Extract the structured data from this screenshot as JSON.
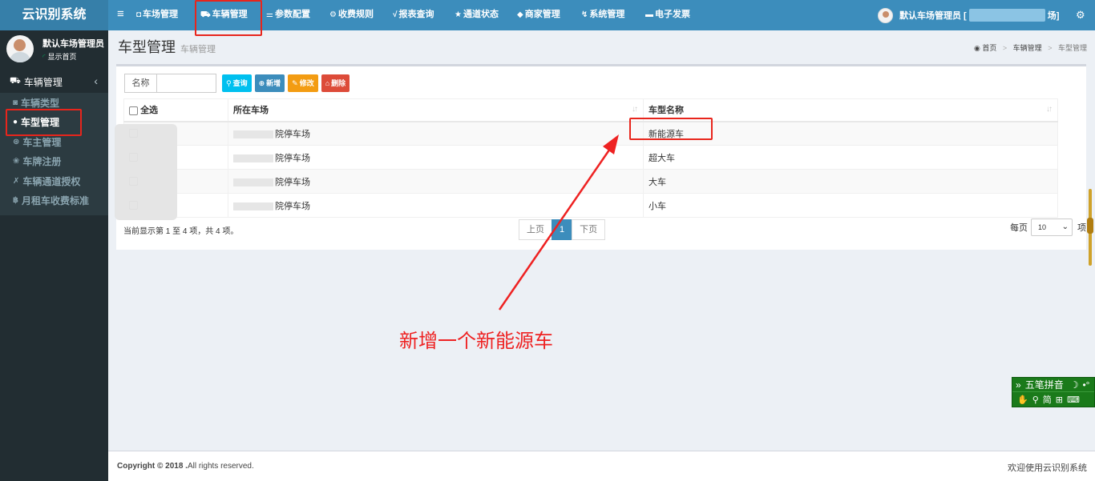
{
  "app": {
    "title": "云识别系统"
  },
  "topnav": [
    {
      "icon": "parking-icon",
      "label": "车场管理"
    },
    {
      "icon": "car-icon",
      "label": "车辆管理"
    },
    {
      "icon": "sliders-icon",
      "label": "参数配置"
    },
    {
      "icon": "gears-icon",
      "label": "收费规则"
    },
    {
      "icon": "chart-icon",
      "label": "报表查询"
    },
    {
      "icon": "star-icon",
      "label": "通道状态"
    },
    {
      "icon": "tag-icon",
      "label": "商家管理"
    },
    {
      "icon": "wrench-icon",
      "label": "系统管理"
    },
    {
      "icon": "invoice-icon",
      "label": "电子发票"
    }
  ],
  "user": {
    "name_prefix": "默认车场管理员 [",
    "name_suffix": "场]",
    "sidebar_name": "默认车场管理员",
    "status": "显示首页"
  },
  "sidebar": {
    "section": "车辆管理",
    "items": [
      {
        "icon": "car-type-icon",
        "label": "车辆类型"
      },
      {
        "icon": "car-model-icon",
        "label": "车型管理"
      },
      {
        "icon": "owner-icon",
        "label": "车主管理"
      },
      {
        "icon": "plate-icon",
        "label": "车牌注册"
      },
      {
        "icon": "channel-icon",
        "label": "车辆通道授权"
      },
      {
        "icon": "bitcoin-icon",
        "label": "月租车收费标准"
      }
    ]
  },
  "page": {
    "title": "车型管理",
    "subtitle": "车辆管理"
  },
  "breadcrumb": {
    "home": "首页",
    "level1": "车辆管理",
    "level2": "车型管理"
  },
  "search": {
    "label": "名称",
    "value": ""
  },
  "toolbar": {
    "query": "查询",
    "add": "新增",
    "edit": "修改",
    "delete": "删除"
  },
  "table": {
    "columns": [
      "全选",
      "所在车场",
      "车型名称"
    ],
    "rows": [
      {
        "lot": "院停车场",
        "model": "新能源车"
      },
      {
        "lot": "院停车场",
        "model": "超大车"
      },
      {
        "lot": "院停车场",
        "model": "大车"
      },
      {
        "lot": "院停车场",
        "model": "小车"
      }
    ]
  },
  "pagination": {
    "info": "当前显示第 1 至 4 项，共 4 项。",
    "prev": "上页",
    "current": "1",
    "next": "下页",
    "per_page_label": "每页",
    "per_page_value": "10",
    "per_page_unit": "项"
  },
  "annotation": "新增一个新能源车",
  "footer": {
    "copyright_bold": "Copyright © 2018 .",
    "copyright_rest": "All rights reserved.",
    "welcome": "欢迎使用云识别系统"
  },
  "ime": {
    "mode": "五笔拼音",
    "charset": "简"
  },
  "colors": {
    "header": "#3c8dbc",
    "sidebar": "#222d32",
    "annotation_red": "#e8251c"
  }
}
